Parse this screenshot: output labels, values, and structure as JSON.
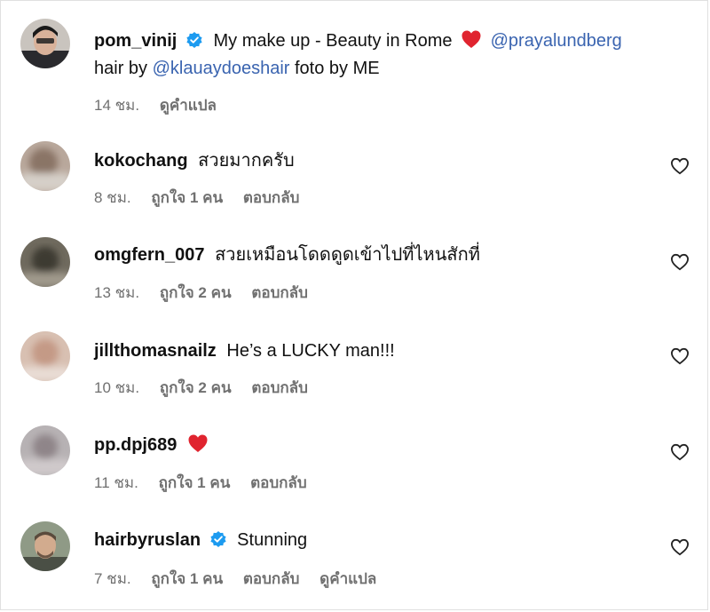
{
  "caption": {
    "username": "pom_vinij",
    "verified": true,
    "text_a": "My make up - Beauty in Rome",
    "mention_a": "@prayalundberg",
    "text_b": "hair by",
    "mention_b": "@klauaydoeshair",
    "text_c": "foto by ME",
    "time": "14 ชม.",
    "translate": "ดูคำแปล"
  },
  "comments": [
    {
      "username": "kokochang",
      "text": "สวยมากครับ",
      "time": "8 ชม.",
      "likes": "ถูกใจ 1 คน",
      "reply": "ตอบกลับ"
    },
    {
      "username": "omgfern_007",
      "text": "สวยเหมือนโดดดูดเข้าไปที่ไหนสักที่",
      "time": "13 ชม.",
      "likes": "ถูกใจ 2 คน",
      "reply": "ตอบกลับ"
    },
    {
      "username": "jillthomasnailz",
      "text": "He’s a LUCKY man!!!",
      "time": "10 ชม.",
      "likes": "ถูกใจ 2 คน",
      "reply": "ตอบกลับ"
    },
    {
      "username": "pp.dpj689",
      "text": "",
      "time": "11 ชม.",
      "likes": "ถูกใจ 1 คน",
      "reply": "ตอบกลับ"
    },
    {
      "username": "hairbyruslan",
      "text": "Stunning",
      "time": "7 ชม.",
      "likes": "ถูกใจ 1 คน",
      "reply": "ตอบกลับ",
      "translate": "ดูคำแปล"
    }
  ],
  "colors": {
    "mention": "#3a64b0",
    "verified": "#1d9bf0",
    "heart": "#e0242f",
    "meta": "#707070"
  },
  "icons": [
    "verified-badge-icon",
    "red-heart-emoji-icon",
    "heart-outline-icon"
  ]
}
